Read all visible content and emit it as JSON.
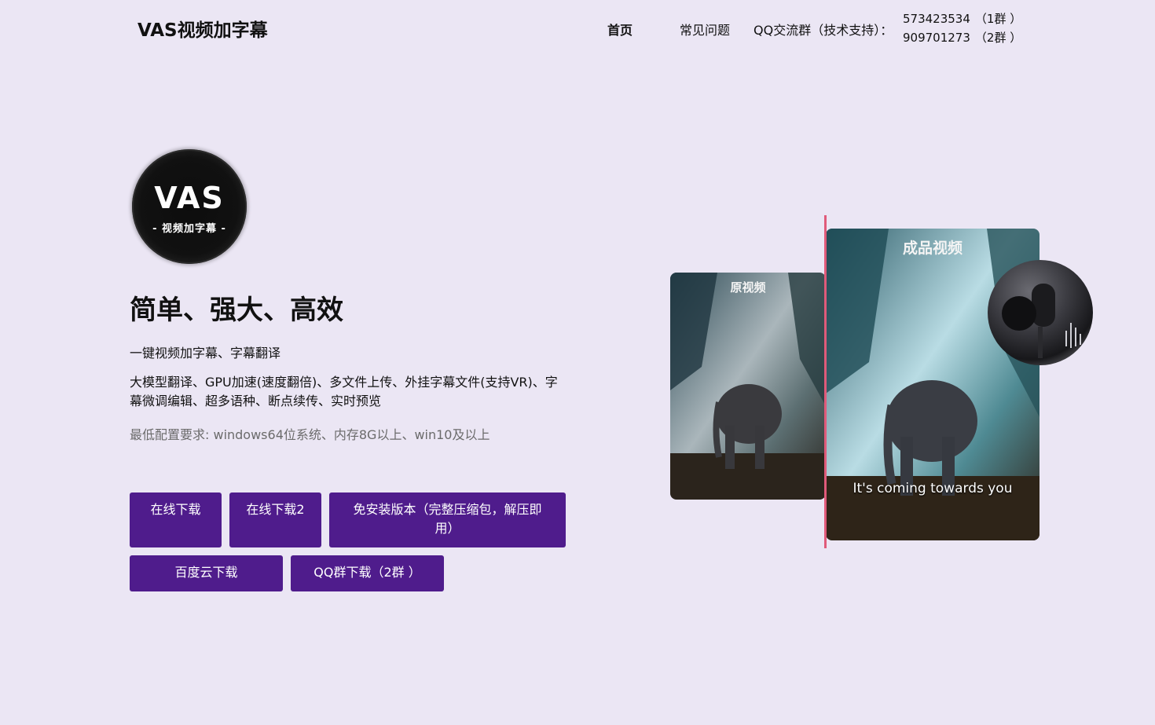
{
  "header": {
    "brand": "VAS视频加字幕",
    "nav_home": "首页",
    "nav_faq": "常见问题",
    "nav_qq": "QQ交流群（技术支持）：",
    "qq_groups": [
      {
        "number": "573423534",
        "label": "（1群 ）"
      },
      {
        "number": "909701273",
        "label": "（2群 ）"
      }
    ]
  },
  "logo": {
    "title": "VAS",
    "subtitle": "- 视频加字幕 -"
  },
  "hero": {
    "headline": "简单、强大、高效",
    "line1": "一键视频加字幕、字幕翻译",
    "line2": "大模型翻译、GPU加速(速度翻倍)、多文件上传、外挂字幕文件(支持VR)、字幕微调编辑、超多语种、断点续传、实时预览",
    "line3": "最低配置要求: windows64位系统、内存8G以上、win10及以上"
  },
  "buttons": {
    "download_online": "在线下载",
    "download_online2": "在线下载2",
    "portable": "免安装版本（完整压缩包，解压即用）",
    "baidu": "百度云下载",
    "qq_download": "QQ群下载（2群 ）"
  },
  "illustration": {
    "original_label": "原视频",
    "final_label": "成品视频",
    "subtitle_text": "It's coming towards you"
  },
  "colors": {
    "background": "#ebe6f4",
    "button": "#4f1c8c",
    "divider": "#e05a7a"
  }
}
